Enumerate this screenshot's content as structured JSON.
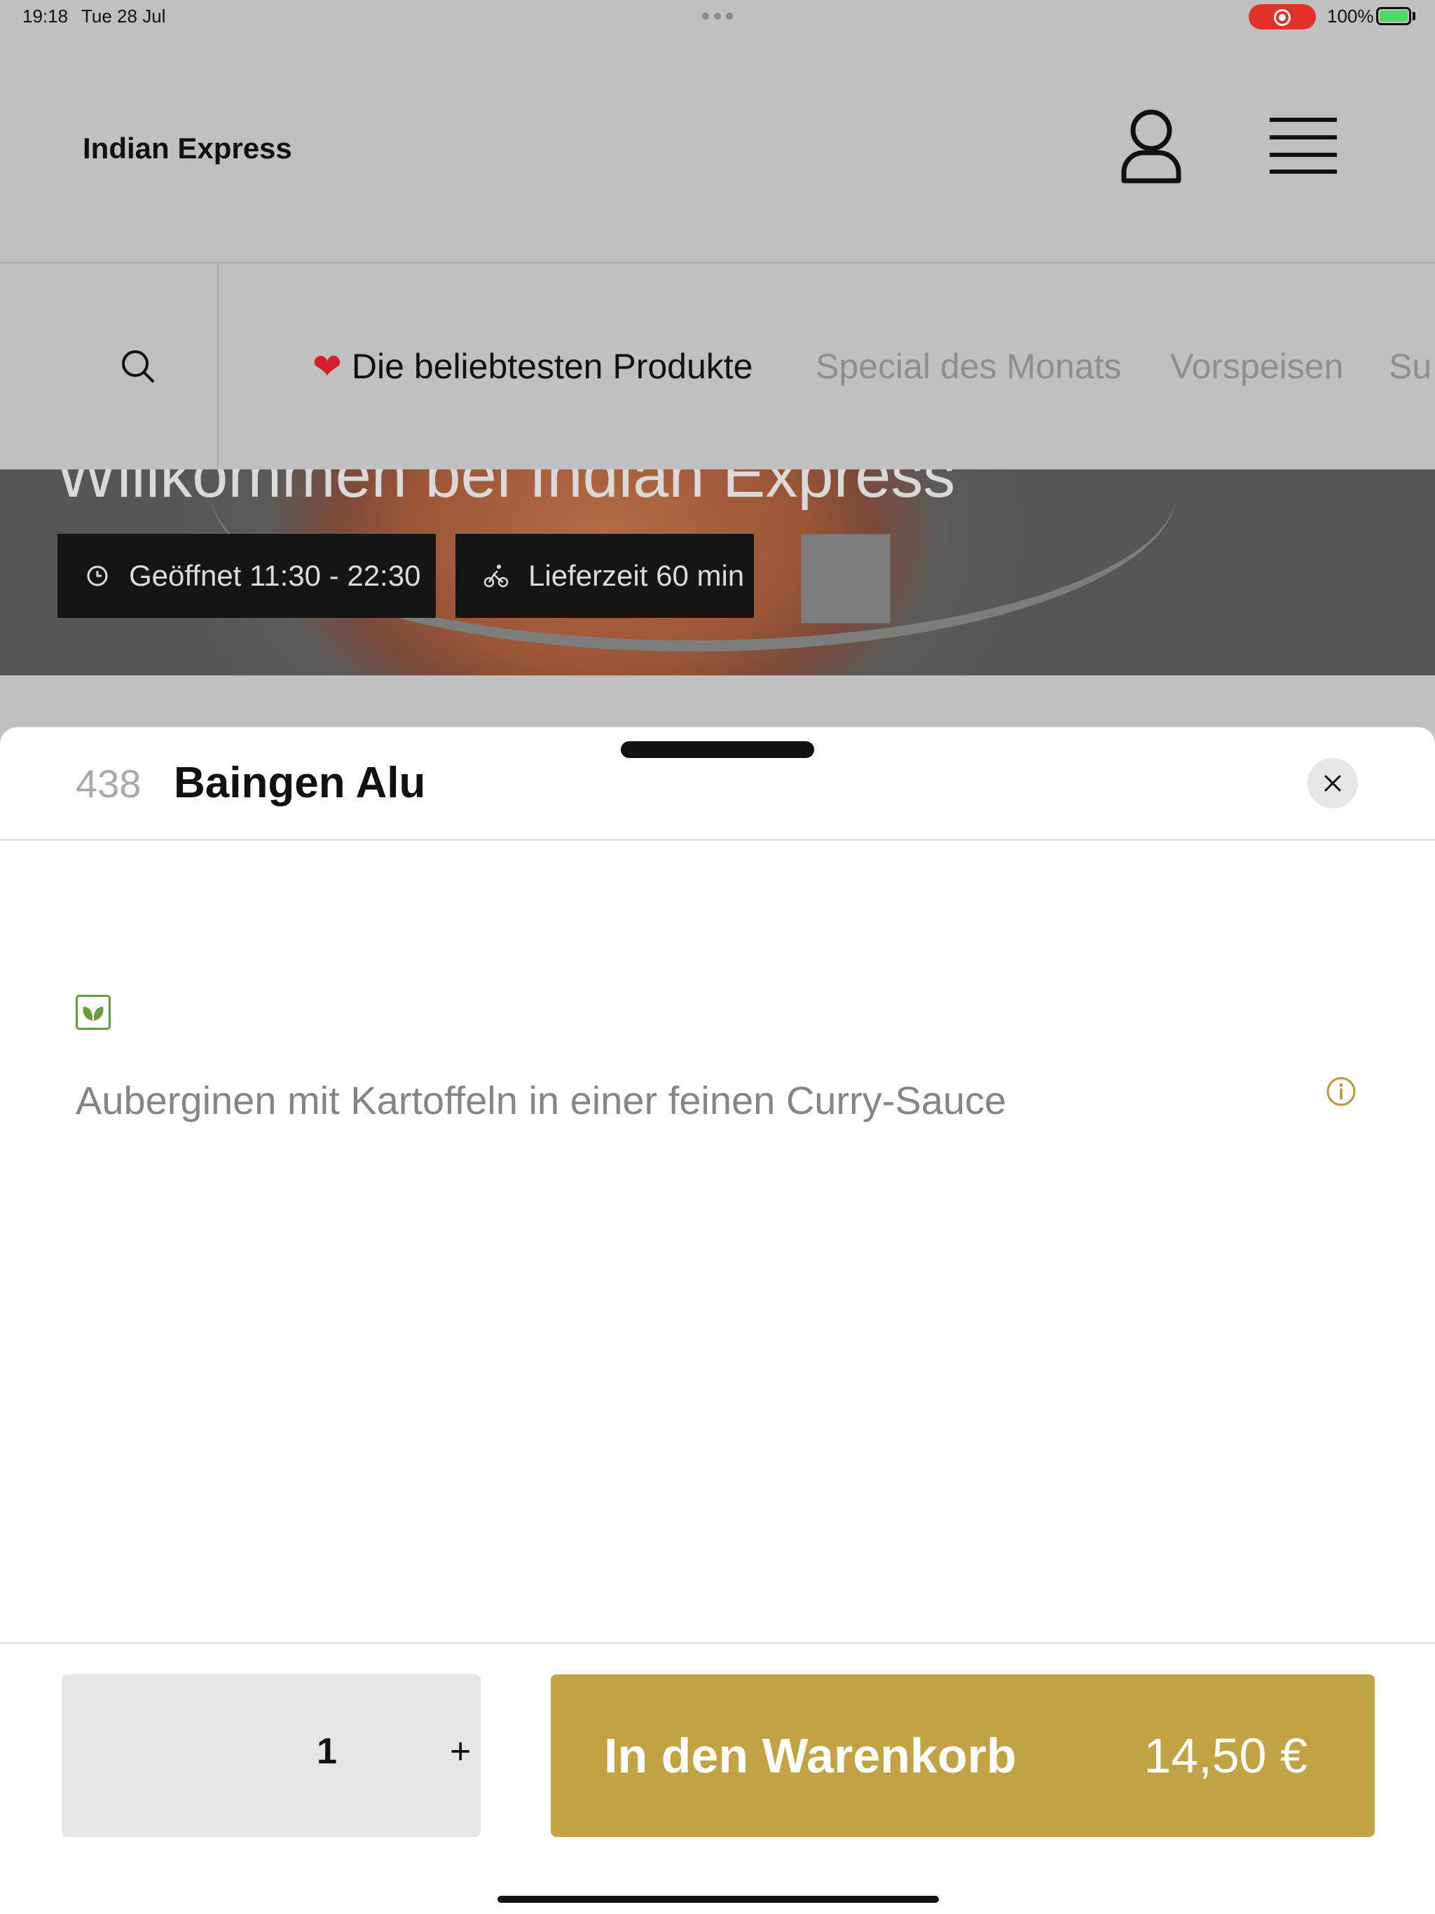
{
  "status_bar": {
    "time": "19:18",
    "date": "Tue 28 Jul",
    "battery": "100%"
  },
  "header": {
    "brand": "Indian Express",
    "icons": [
      "user-icon",
      "menu-icon"
    ]
  },
  "categories": [
    {
      "emoji": "❤️",
      "label": "Die beliebtesten Produkte",
      "active": true
    },
    {
      "label": "Special des Monats",
      "active": false
    },
    {
      "label": "Vorspeisen",
      "active": false
    },
    {
      "label": "Su",
      "active": false
    }
  ],
  "hero": {
    "title": "Willkommen bei Indian Express",
    "opening_hours": "Geöffnet 11:30 - 22:30",
    "delivery_time": "Lieferzeit 60 min"
  },
  "item": {
    "number": "438",
    "name": "Baingen Alu",
    "description": "Auberginen mit Kartoffeln in einer feinen Curry-Sauce",
    "quantity": "1",
    "plus_label": "+",
    "add_label": "In den Warenkorb",
    "price": "14,50 €"
  },
  "colors": {
    "accent": "#c2a344",
    "veg_green": "#6b9a3b",
    "record_red": "#e2302a"
  }
}
